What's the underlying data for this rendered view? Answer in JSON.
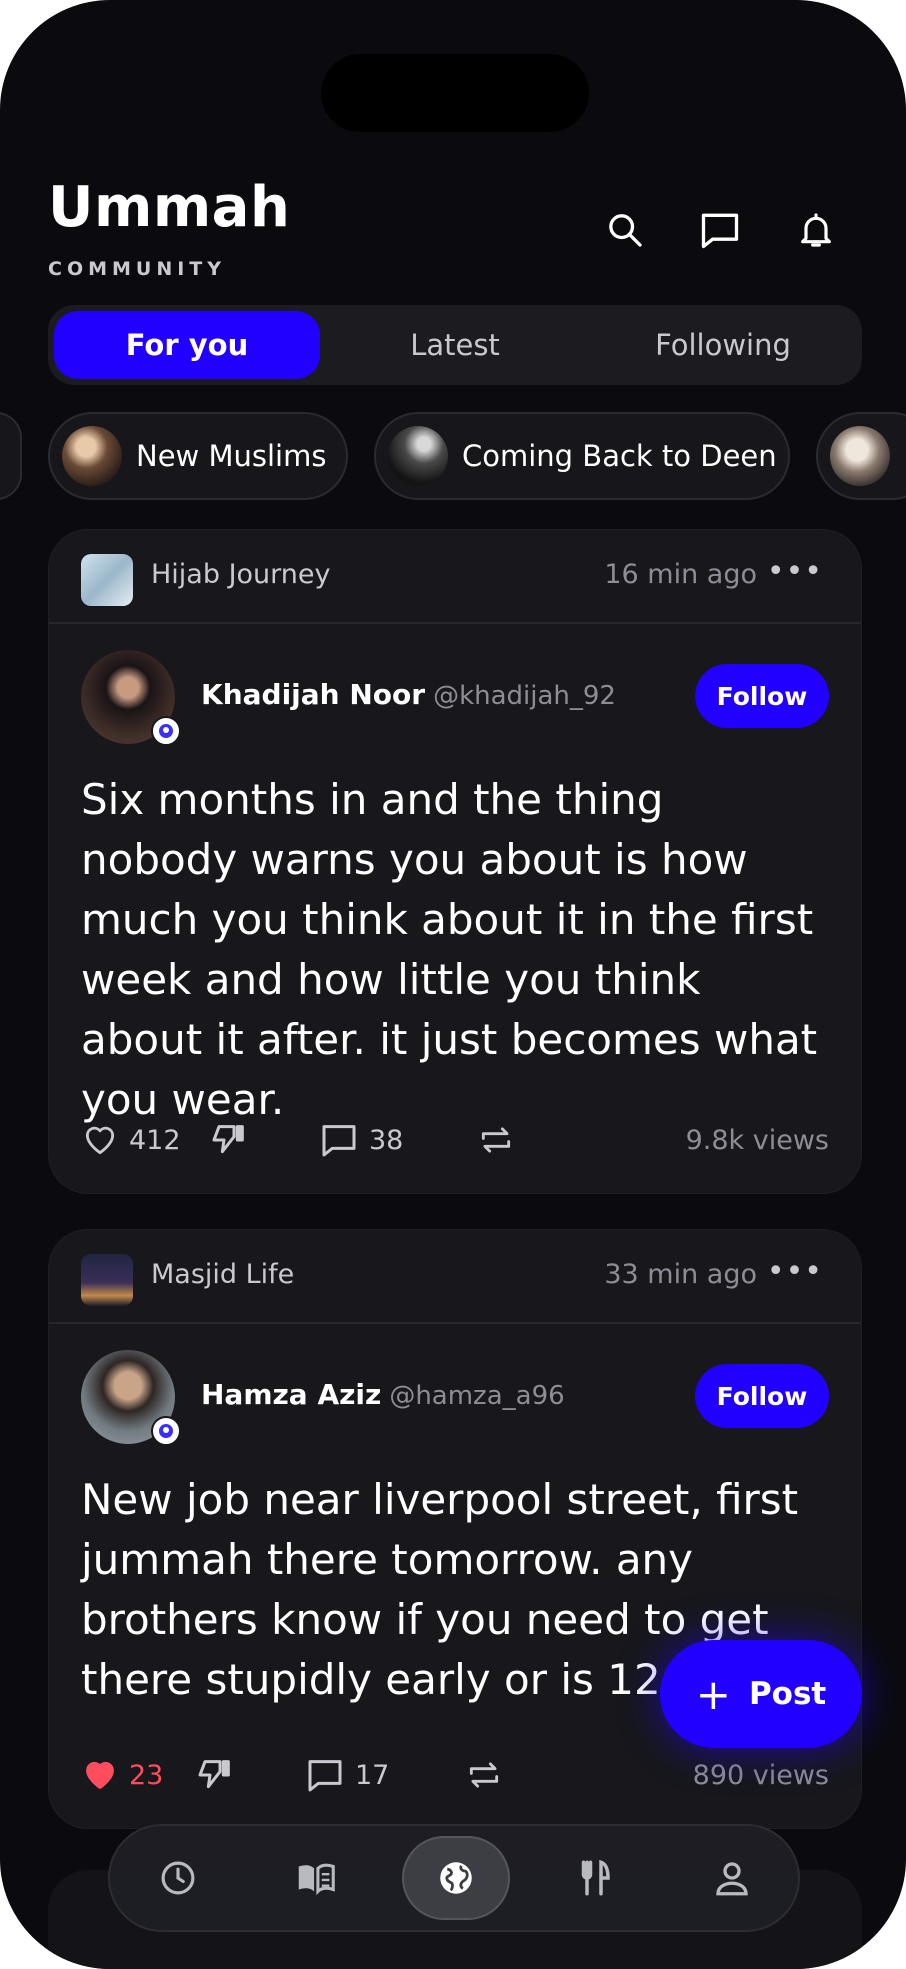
{
  "app": {
    "title": "Ummah",
    "subtitle": "COMMUNITY"
  },
  "header_icons": [
    "search-icon",
    "message-icon",
    "bell-icon"
  ],
  "tabs": [
    {
      "label": "For you",
      "active": true
    },
    {
      "label": "Latest",
      "active": false
    },
    {
      "label": "Following",
      "active": false
    }
  ],
  "chips": [
    {
      "label": "New Muslims"
    },
    {
      "label": "Coming Back to Deen"
    }
  ],
  "posts": [
    {
      "group": "Hijab Journey",
      "time": "16 min ago",
      "author": "Khadijah Noor",
      "handle": "@khadijah_92",
      "follow_label": "Follow",
      "text": "Six months in and the thing nobody warns you about is how much you think about it in the first week and how little you think about it after. it just becomes what you wear.",
      "likes": "412",
      "liked": false,
      "comments": "38",
      "views": "9.8k views"
    },
    {
      "group": "Masjid Life",
      "time": "33 min ago",
      "author": "Hamza Aziz",
      "handle": "@hamza_a96",
      "follow_label": "Follow",
      "text": "New job near liverpool street, first jummah there tomorrow. any brothers know if you need to get there stupidly early or is 12:45 fine",
      "likes": "23",
      "liked": true,
      "comments": "17",
      "views": "890 views"
    }
  ],
  "fab": {
    "label": "Post"
  },
  "bottom_nav": [
    "clock-icon",
    "book-icon",
    "globe-icon",
    "utensils-icon",
    "profile-icon"
  ],
  "colors": {
    "accent": "#2200ff",
    "background": "#0b0b0f",
    "card": "#17171c",
    "like": "#ff4d5e"
  }
}
